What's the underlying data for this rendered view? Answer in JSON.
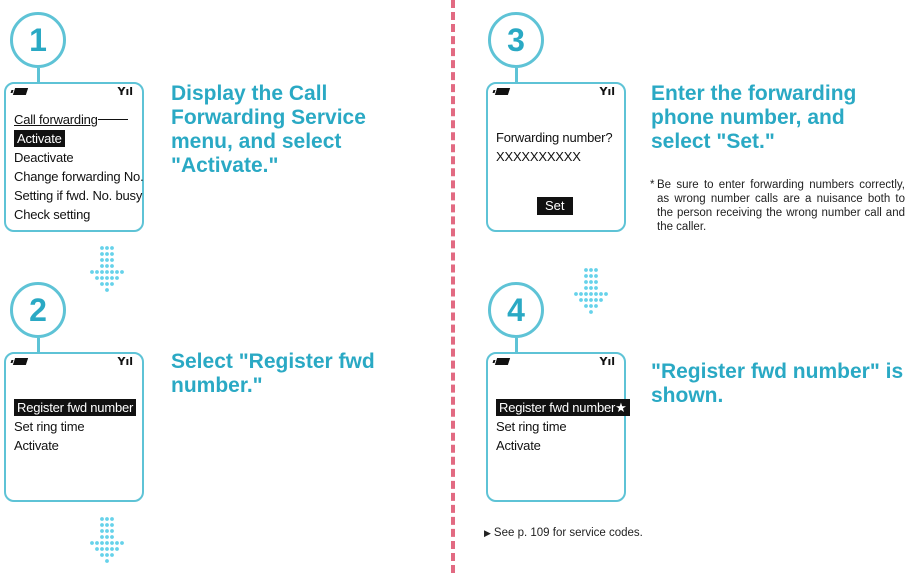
{
  "steps": [
    {
      "number": "1",
      "heading": "Display the Call Forwarding Service menu, and select \"Activate.\"",
      "screen": {
        "title": "Call forwarding",
        "selected": "Activate",
        "items": [
          "Deactivate",
          "Change forwarding No.",
          "Setting if fwd. No. busy",
          "Check setting"
        ]
      }
    },
    {
      "number": "2",
      "heading": "Select \"Register fwd number.\"",
      "screen": {
        "selected": "Register fwd number",
        "items": [
          "Set ring time",
          "Activate"
        ]
      }
    },
    {
      "number": "3",
      "heading": "Enter the forwarding phone number, and select \"Set.\"",
      "screen": {
        "prompt": "Forwarding number?",
        "value": "XXXXXXXXXX",
        "button": "Set"
      },
      "note": "Be sure to enter forwarding numbers correctly, as wrong number calls are a nuisance both to the person receiving the wrong number call and the caller."
    },
    {
      "number": "4",
      "heading": "\"Register fwd number\" is shown.",
      "screen": {
        "selected": "Register fwd number★",
        "items": [
          "Set ring time",
          "Activate"
        ]
      }
    }
  ],
  "note_marker": "*",
  "reference": "See p. 109 for service codes.",
  "signal_glyph": "Yıl",
  "colors": {
    "accent": "#2aa9c4",
    "border": "#5ec3d6",
    "divider": "#e26a82",
    "arrow": "#66d2ea"
  }
}
